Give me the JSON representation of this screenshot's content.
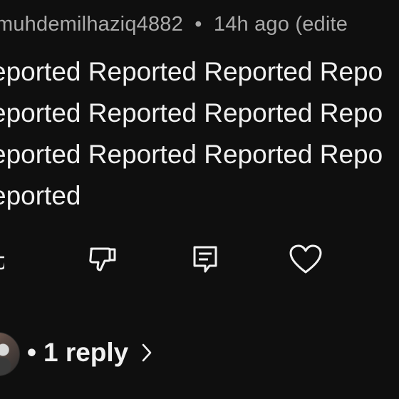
{
  "comment": {
    "author": "muhdemilhaziq4882",
    "separator": "•",
    "time": "14h ago (edite",
    "text": "eported Reported Reported Repo\neported Reported Reported Repo\neported Reported Reported Repo\neported"
  },
  "actions": {
    "like_icon": "thumbs-up-icon",
    "dislike_icon": "thumbs-down-icon",
    "reply_icon": "reply-comment-icon",
    "heart_icon": "heart-icon"
  },
  "replies": {
    "dot": "•",
    "label": "1 reply",
    "chevron_icon": "chevron-right-icon"
  },
  "colors": {
    "background": "#0f0f0f",
    "text": "#f1f1f1",
    "meta": "#aaaaaa"
  }
}
